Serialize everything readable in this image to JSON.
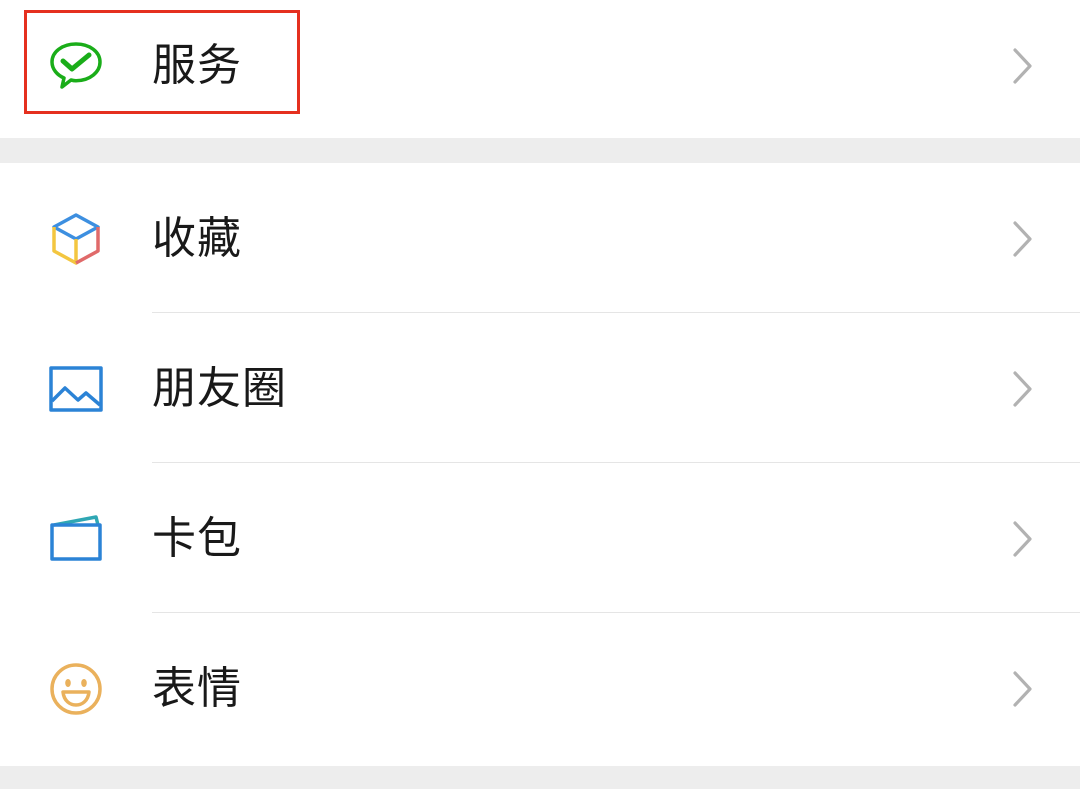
{
  "menu": {
    "top_item": {
      "label": "服务",
      "icon": "service-wechat-pay-icon"
    },
    "items": [
      {
        "label": "收藏",
        "icon": "favorites-cube-icon"
      },
      {
        "label": "朋友圈",
        "icon": "moments-picture-icon"
      },
      {
        "label": "卡包",
        "icon": "card-wallet-icon"
      },
      {
        "label": "表情",
        "icon": "sticker-smiley-icon"
      }
    ]
  },
  "colors": {
    "highlight_border": "#e5301f",
    "service_green": "#1aad19",
    "text": "#191919",
    "chevron": "#b2b2b2",
    "background": "#ededed"
  }
}
